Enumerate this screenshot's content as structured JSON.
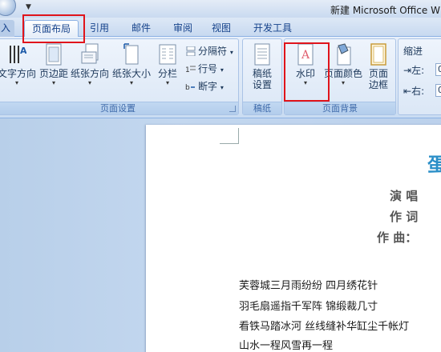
{
  "window": {
    "title": "新建 Microsoft Office W"
  },
  "tabs": [
    {
      "label": "入",
      "active": false
    },
    {
      "label": "页面布局",
      "active": true
    },
    {
      "label": "引用",
      "active": false
    },
    {
      "label": "邮件",
      "active": false
    },
    {
      "label": "审阅",
      "active": false
    },
    {
      "label": "视图",
      "active": false
    },
    {
      "label": "开发工具",
      "active": false
    }
  ],
  "ribbon": {
    "page_setup": {
      "label": "页面设置",
      "text_direction": "文字方向",
      "margins": "页边距",
      "orientation": "纸张方向",
      "size": "纸张大小",
      "columns": "分栏",
      "breaks": "分隔符",
      "line_numbers": "行号",
      "hyphenation": "断字"
    },
    "manuscript": {
      "label": "稿纸",
      "settings_line1": "稿纸",
      "settings_line2": "设置"
    },
    "page_background": {
      "label": "页面背景",
      "watermark": "水印",
      "page_color": "页面颜色",
      "borders_line1": "页面",
      "borders_line2": "边框"
    },
    "indent": {
      "label": "缩进",
      "left": "左:",
      "right": "右:",
      "left_value": "0",
      "right_value": "0"
    }
  },
  "document": {
    "title_char": "蛋",
    "singer": "演 唱",
    "lyricist": "作 词",
    "composer": "作 曲：",
    "lyrics": [
      "芙蓉城三月雨纷纷 四月绣花针",
      "羽毛扇遥指千军阵 锦缎裁几寸",
      "看铁马踏冰河 丝线缝补华缸尘千帐灯",
      "山水一程风雪再一程"
    ]
  },
  "colors": {
    "accent": "#15428b",
    "highlight": "#e0141b",
    "title_blue": "#2b8fc8"
  }
}
